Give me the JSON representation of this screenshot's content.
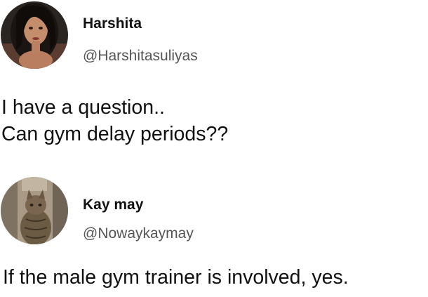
{
  "posts": [
    {
      "display_name": "Harshita",
      "handle": "@Harshitasuliyas",
      "text_lines": [
        "I have a question..",
        "Can gym delay periods??"
      ]
    },
    {
      "display_name": "Kay may",
      "handle": "@Nowaykaymay",
      "text_lines": [
        "If the male gym trainer is involved, yes."
      ]
    }
  ]
}
